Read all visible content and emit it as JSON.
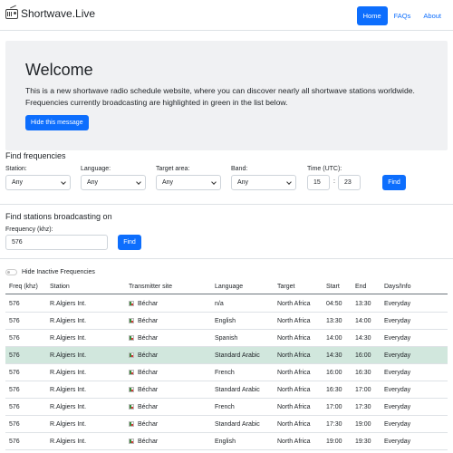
{
  "navbar": {
    "brand": "Shortwave.Live",
    "links": [
      {
        "label": "Home",
        "active": true
      },
      {
        "label": "FAQs",
        "active": false
      },
      {
        "label": "About",
        "active": false
      }
    ]
  },
  "hero": {
    "title": "Welcome",
    "text": "This is a new shortwave radio schedule website, where you can discover nearly all shortwave stations worldwide. Frequencies currently broadcasting are highlighted in green in the list below.",
    "button": "Hide this message"
  },
  "find_frequencies": {
    "title": "Find frequencies",
    "station_label": "Station:",
    "station_value": "Any",
    "language_label": "Language:",
    "language_value": "Any",
    "target_label": "Target area:",
    "target_value": "Any",
    "band_label": "Band:",
    "band_value": "Any",
    "time_label": "Time (UTC):",
    "time_hour": "15",
    "time_sep": ":",
    "time_minute": "23",
    "find_button": "Find"
  },
  "find_stations": {
    "title": "Find stations broadcasting on",
    "freq_label": "Frequency (khz):",
    "freq_value": "576",
    "find_button": "Find"
  },
  "filter": {
    "hide_inactive_label": "Hide Inactive Frequencies",
    "hide_inactive": false
  },
  "table": {
    "headers": [
      "Freq (khz)",
      "Station",
      "Transmitter site",
      "Language",
      "Target",
      "Start",
      "End",
      "Days/Info"
    ],
    "rows": [
      {
        "freq": "576",
        "station": "R.Algiers Int.",
        "site": "Béchar",
        "language": "n/a",
        "target": "North Africa",
        "start": "04:50",
        "end": "13:30",
        "days": "Everyday",
        "active": false
      },
      {
        "freq": "576",
        "station": "R.Algiers Int.",
        "site": "Béchar",
        "language": "English",
        "target": "North Africa",
        "start": "13:30",
        "end": "14:00",
        "days": "Everyday",
        "active": false
      },
      {
        "freq": "576",
        "station": "R.Algiers Int.",
        "site": "Béchar",
        "language": "Spanish",
        "target": "North Africa",
        "start": "14:00",
        "end": "14:30",
        "days": "Everyday",
        "active": false
      },
      {
        "freq": "576",
        "station": "R.Algiers Int.",
        "site": "Béchar",
        "language": "Standard Arabic",
        "target": "North Africa",
        "start": "14:30",
        "end": "16:00",
        "days": "Everyday",
        "active": true
      },
      {
        "freq": "576",
        "station": "R.Algiers Int.",
        "site": "Béchar",
        "language": "French",
        "target": "North Africa",
        "start": "16:00",
        "end": "16:30",
        "days": "Everyday",
        "active": false
      },
      {
        "freq": "576",
        "station": "R.Algiers Int.",
        "site": "Béchar",
        "language": "Standard Arabic",
        "target": "North Africa",
        "start": "16:30",
        "end": "17:00",
        "days": "Everyday",
        "active": false
      },
      {
        "freq": "576",
        "station": "R.Algiers Int.",
        "site": "Béchar",
        "language": "French",
        "target": "North Africa",
        "start": "17:00",
        "end": "17:30",
        "days": "Everyday",
        "active": false
      },
      {
        "freq": "576",
        "station": "R.Algiers Int.",
        "site": "Béchar",
        "language": "Standard Arabic",
        "target": "North Africa",
        "start": "17:30",
        "end": "19:00",
        "days": "Everyday",
        "active": false
      },
      {
        "freq": "576",
        "station": "R.Algiers Int.",
        "site": "Béchar",
        "language": "English",
        "target": "North Africa",
        "start": "19:00",
        "end": "19:30",
        "days": "Everyday",
        "active": false
      }
    ]
  },
  "colors": {
    "primary": "#0d6efd",
    "active_row": "#d1e7dd",
    "hero_bg": "#f0f1f3",
    "flag_green": "#3a8a3a"
  },
  "icons": {
    "brand": "radio-icon",
    "site": "algeria-flag-icon"
  }
}
